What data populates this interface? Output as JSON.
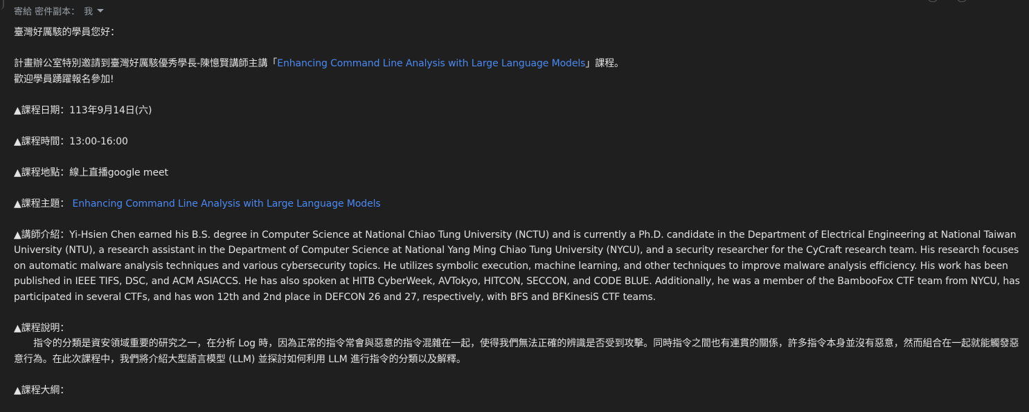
{
  "header": {
    "recipients_label": "寄給 密件副本：",
    "recipient_name": "我"
  },
  "body": {
    "greeting": "臺灣好厲駭的學員您好：",
    "intro_prefix": "計畫辦公室特別邀請到臺灣好厲駭優秀學長-陳憶賢講師主講「",
    "intro_link": "Enhancing Command Line Analysis with Large Language Models",
    "intro_suffix": "」課程。",
    "welcome": "歡迎學員踴躍報名參加!",
    "date_line": "▲課程日期：113年9月14日(六)",
    "time_line": "▲課程時間：13:00-16:00",
    "location_line": "▲課程地點：線上直播google meet",
    "topic_label": "▲課程主題：",
    "topic_link": "Enhancing Command Line Analysis with Large Language Models",
    "instructor_text": "▲講師介紹：Yi-Hsien Chen earned his B.S. degree in Computer Science at National Chiao Tung University (NCTU) and is currently a Ph.D. candidate in the Department of Electrical Engineering at National Taiwan University (NTU), a research assistant in the Department of Computer Science at National Yang Ming Chiao Tung University (NYCU), and a security researcher for the CyCraft research team. His research focuses on automatic malware analysis techniques and various cybersecurity topics. He utilizes symbolic execution, machine learning, and other techniques to improve malware analysis efficiency. His work has been published in IEEE TIFS, DSC, and ACM ASIACCS. He has also spoken at HITB CyberWeek, AVTokyo, HITCON, SECCON, and CODE BLUE. Additionally, he was a member of the BambooFox CTF team from NYCU, has participated in several CTFs, and has won 12th and 2nd place in DEFCON 26 and 27, respectively, with BFS and BFKinesiS CTF teams.",
    "description_label": "▲課程說明：",
    "description_text": "指令的分類是資安領域重要的研究之一，在分析 Log 時，因為正常的指令常會與惡意的指令混雜在一起，使得我們無法正確的辨識是否受到攻擊。同時指令之間也有連貫的關係，許多指令本身並沒有惡意，然而組合在一起就能觸發惡意行為。在此次課程中，我們將介紹大型語言模型 (LLM) 並探討如何利用 LLM 進行指令的分類以及解釋。",
    "outline_label": "▲課程大綱："
  }
}
